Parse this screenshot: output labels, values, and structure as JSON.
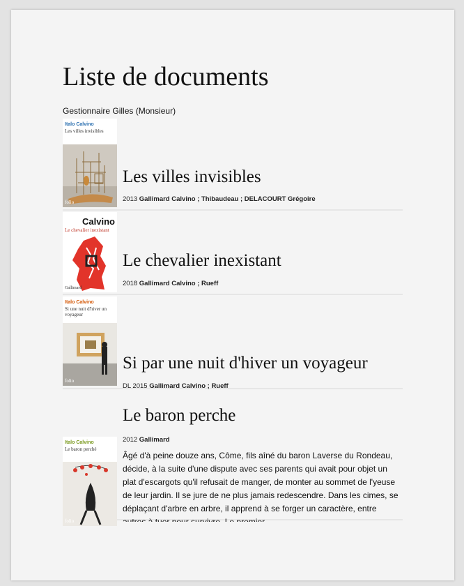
{
  "page": {
    "title": "Liste de documents",
    "manager": "Gestionnaire Gilles (Monsieur)"
  },
  "documents": [
    {
      "title": "Les villes invisibles",
      "year": "2013",
      "publisher": "Gallimard",
      "authors": "Calvino ; Thibaudeau ; DELACOURT Grégoire",
      "cover": {
        "author": "Italo Calvino",
        "title": "Les villes invisibles",
        "imprint": "folio"
      }
    },
    {
      "title": "Le chevalier inexistant",
      "year": "2018",
      "publisher": "Gallimard",
      "authors": "Calvino ; Rueff",
      "cover": {
        "author": "Calvino",
        "title": "Le chevalier inexistant",
        "imprint": "Gallimard"
      }
    },
    {
      "title": "Si par une nuit d'hiver un voyageur",
      "year": "DL 2015",
      "publisher": "Gallimard",
      "authors": "Calvino ; Rueff",
      "cover": {
        "author": "Italo Calvino",
        "title": "Si une nuit d'hiver un voyageur",
        "imprint": "folio"
      }
    },
    {
      "title": "Le baron perche",
      "year": "2012",
      "publisher": "Gallimard",
      "authors": "Calvino",
      "summary": "Âgé d'à peine douze ans, Côme, fils aîné du baron Laverse du Rondeau, décide, à la suite d'une dispute avec ses parents qui avait pour objet un plat d'escargots qu'il refusait de manger, de monter au sommet de l'yeuse de leur jardin. Il se jure de ne plus jamais redescendre. Dans les cimes, se déplaçant d'arbre en arbre, il apprend à se forger un caractère, entre autres à tuer pour survivre. Le premier",
      "cover": {
        "author": "Italo Calvino",
        "title": "Le baron perché",
        "imprint": "folio"
      }
    }
  ]
}
